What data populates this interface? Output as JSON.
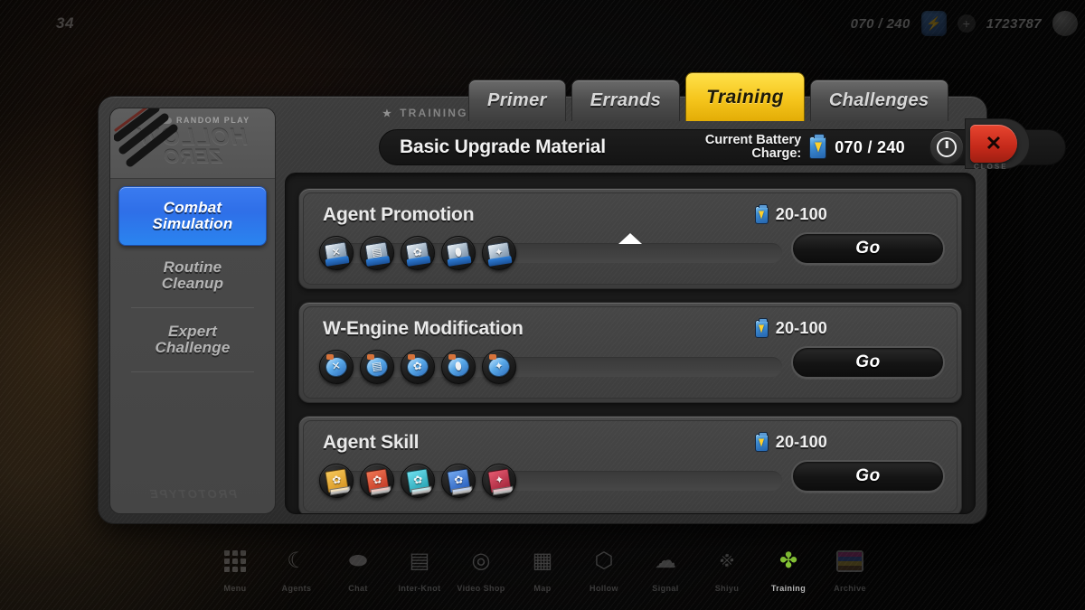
{
  "topbar": {
    "level": "34",
    "battery_value": "070 / 240",
    "battery_icon": "battery-icon",
    "currency_value": "1723787",
    "currency_icon": "denny-coin-icon",
    "add_label": "+"
  },
  "tabs": [
    {
      "label": "Primer",
      "active": false
    },
    {
      "label": "Errands",
      "active": false
    },
    {
      "label": "Training",
      "active": true
    },
    {
      "label": "Challenges",
      "active": false
    }
  ],
  "sidebar": {
    "badge": "RANDOM PLAY",
    "logo_line1": "HOLLOW",
    "logo_line2": "ZERO",
    "watermark": "PROTOTYPE",
    "items": [
      {
        "label_line1": "Combat",
        "label_line2": "Simulation",
        "active": true
      },
      {
        "label_line1": "Routine",
        "label_line2": "Cleanup",
        "active": false
      },
      {
        "label_line1": "Expert",
        "label_line2": "Challenge",
        "active": false
      }
    ]
  },
  "header": {
    "breadcrumb": "TRAINING",
    "breadcrumb_star": "★",
    "title": "Basic Upgrade Material",
    "charge_label_line1": "Current Battery",
    "charge_label_line2": "Charge:",
    "charge_value": "070 / 240",
    "info_button": "info-button"
  },
  "scroll_arrow": "scroll-up-arrow",
  "cards": [
    {
      "title": "Agent Promotion",
      "cost": "20-100",
      "go_label": "Go",
      "icon_style": "mat",
      "icons": [
        {
          "name": "material-basic-icon",
          "glyph": "✕",
          "tint": "#8fa6bc"
        },
        {
          "name": "material-plating-icon",
          "glyph": "▤",
          "tint": "#9fb2c6"
        },
        {
          "name": "material-core-icon",
          "glyph": "✿",
          "tint": "#97acc2"
        },
        {
          "name": "material-rod-icon",
          "glyph": "⬮",
          "tint": "#a3b6c9"
        },
        {
          "name": "material-shield-icon",
          "glyph": "✦",
          "tint": "#8aa3ba"
        }
      ]
    },
    {
      "title": "W-Engine Modification",
      "cost": "20-100",
      "go_label": "Go",
      "icon_style": "eng",
      "icons": [
        {
          "name": "engine-basic-icon",
          "glyph": "✕",
          "tint": "#58a8e8"
        },
        {
          "name": "engine-plating-icon",
          "glyph": "▤",
          "tint": "#63b0ec"
        },
        {
          "name": "engine-core-icon",
          "glyph": "✿",
          "tint": "#5aaae9"
        },
        {
          "name": "engine-rod-icon",
          "glyph": "⬮",
          "tint": "#6cb5ee"
        },
        {
          "name": "engine-shield-icon",
          "glyph": "✦",
          "tint": "#52a3e4"
        }
      ]
    },
    {
      "title": "Agent Skill",
      "cost": "20-100",
      "go_label": "Go",
      "icon_style": "bk",
      "icons": [
        {
          "name": "skill-book-gold-icon",
          "glyph": "✿",
          "tint": "#e8a42a"
        },
        {
          "name": "skill-book-red-icon",
          "glyph": "✿",
          "tint": "#d6452c"
        },
        {
          "name": "skill-book-cyan-icon",
          "glyph": "✿",
          "tint": "#2fb6c9"
        },
        {
          "name": "skill-book-blue-icon",
          "glyph": "✿",
          "tint": "#2f74d6"
        },
        {
          "name": "skill-book-crimson-icon",
          "glyph": "✦",
          "tint": "#c9334a"
        }
      ]
    }
  ],
  "close_button": {
    "glyph": "✕",
    "caption": "CLOSE"
  },
  "bottomnav": [
    {
      "icon": "grid-menu-icon",
      "label": "Menu",
      "active": false
    },
    {
      "icon": "agents-icon",
      "label": "Agents",
      "active": false
    },
    {
      "icon": "chat-icon",
      "label": "Chat",
      "active": false
    },
    {
      "icon": "inter-knot-icon",
      "label": "Inter-Knot",
      "active": false
    },
    {
      "icon": "video-shop-icon",
      "label": "Video Shop",
      "active": false
    },
    {
      "icon": "map-icon",
      "label": "Map",
      "active": false
    },
    {
      "icon": "hollow-icon",
      "label": "Hollow",
      "active": false
    },
    {
      "icon": "scratch-icon",
      "label": "Signal",
      "active": false
    },
    {
      "icon": "shiyu-icon",
      "label": "Shiyu",
      "active": false
    },
    {
      "icon": "training-icon",
      "label": "Training",
      "active": true
    },
    {
      "icon": "vhs-icon",
      "label": "Archive",
      "active": false
    }
  ]
}
